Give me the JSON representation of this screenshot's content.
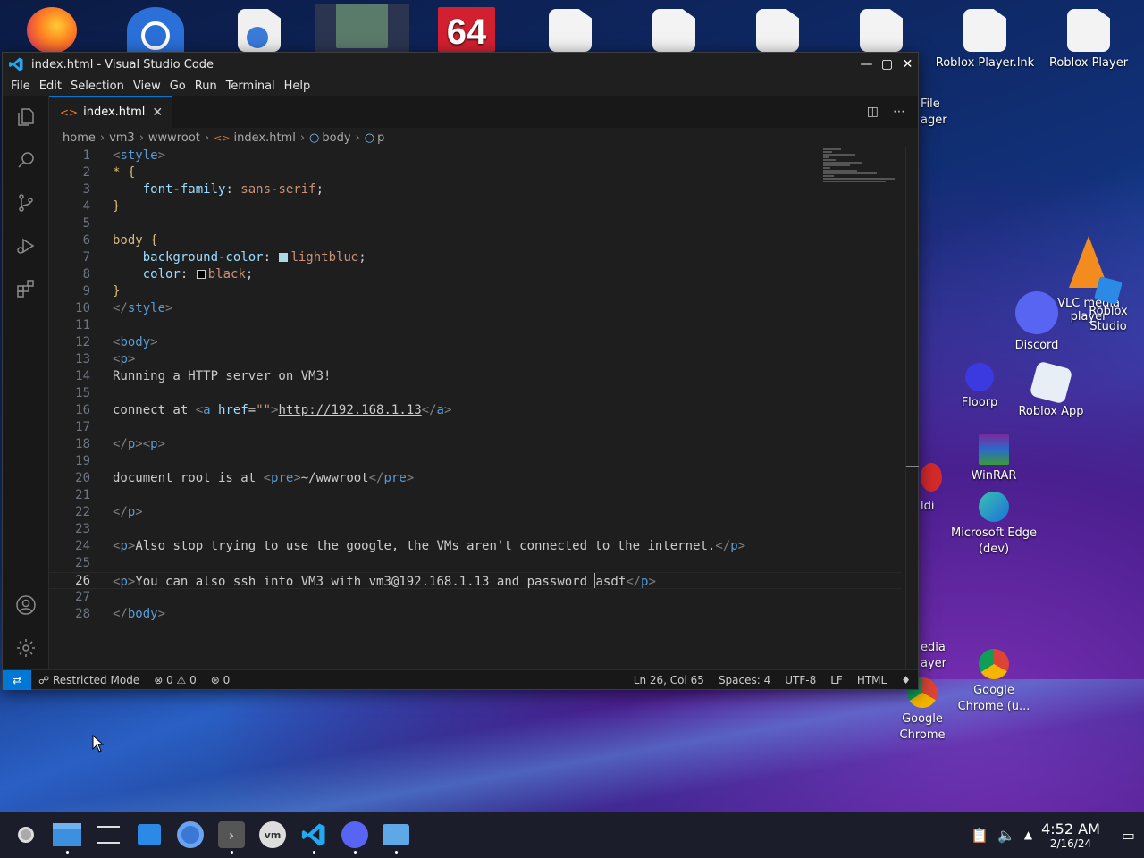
{
  "window": {
    "title": "index.html - Visual Studio Code",
    "menu": [
      "File",
      "Edit",
      "Selection",
      "View",
      "Go",
      "Run",
      "Terminal",
      "Help"
    ]
  },
  "tab": {
    "label": "index.html"
  },
  "breadcrumb": [
    "home",
    "vm3",
    "wwwroot",
    "index.html",
    "body",
    "p"
  ],
  "editor": {
    "current_line": 26,
    "line_numbers": [
      "1",
      "2",
      "3",
      "4",
      "5",
      "6",
      "7",
      "8",
      "9",
      "10",
      "11",
      "12",
      "13",
      "14",
      "15",
      "16",
      "17",
      "18",
      "19",
      "20",
      "21",
      "22",
      "23",
      "24",
      "25",
      "26",
      "27",
      "28"
    ],
    "code": {
      "l1_tag": "style",
      "l2": "* {",
      "l3_prop": "font-family",
      "l3_val": "sans-serif",
      "l6": "body {",
      "l7_prop": "background-color",
      "l7_val": "lightblue",
      "l8_prop": "color",
      "l8_val": "black",
      "l12_tag": "body",
      "l13_tag": "p",
      "l14": "Running a HTTP server on VM3!",
      "l16_text": "connect at ",
      "l16_attr": "href",
      "l16_link": "http://192.168.1.13",
      "l20_text": "document root is at ",
      "l20_pre": "~/wwwroot",
      "l24": "Also stop trying to use the google, the VMs aren't connected to the internet.",
      "l26_a": "You can also ssh into VM3 with vm3@192.168.1.13 and password ",
      "l26_b": "asdf"
    },
    "swatch_colors": {
      "lightblue": "#add8e6",
      "black": "#000000"
    }
  },
  "statusbar": {
    "restricted": "Restricted Mode",
    "errors": "0",
    "warnings": "0",
    "ports": "0",
    "position": "Ln 26, Col 65",
    "spaces": "Spaces: 4",
    "encoding": "UTF-8",
    "eol": "LF",
    "language": "HTML"
  },
  "desktop": {
    "icons": [
      {
        "label": "Roblox Player.lnk"
      },
      {
        "label": "Roblox Player"
      },
      {
        "label": "VLC media player"
      },
      {
        "label": "Roblox Studio"
      },
      {
        "label": "Discord"
      },
      {
        "label": "Floorp"
      },
      {
        "label": "Roblox App"
      },
      {
        "label": "WinRAR"
      },
      {
        "label": "Microsoft Edge (dev)"
      },
      {
        "label": "Google Chrome"
      },
      {
        "label": "Google Chrome (u..."
      }
    ],
    "partial": [
      "File",
      "ager",
      "ldi",
      "edia",
      "ayer"
    ]
  },
  "taskbar": {
    "time": "4:52 AM",
    "date": "2/16/24"
  },
  "colors": {
    "accent": "#0078d4",
    "editor_bg": "#1e1e1e"
  }
}
